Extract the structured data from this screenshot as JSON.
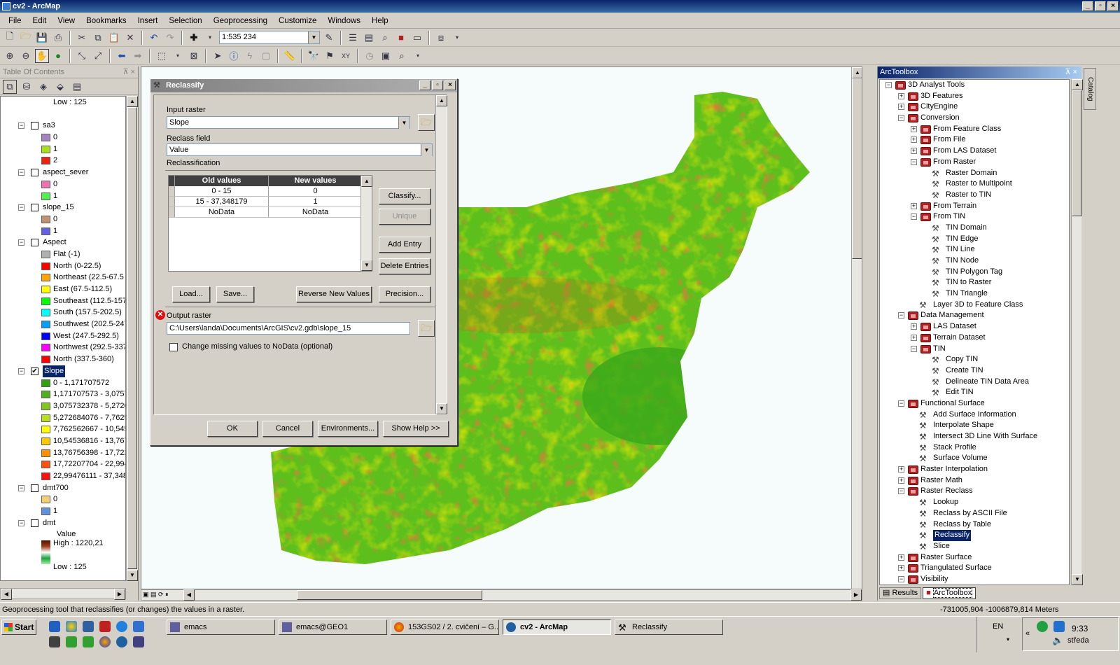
{
  "window": {
    "title": "cv2 - ArcMap"
  },
  "menu": [
    "File",
    "Edit",
    "View",
    "Bookmarks",
    "Insert",
    "Selection",
    "Geoprocessing",
    "Customize",
    "Windows",
    "Help"
  ],
  "toolbar": {
    "scale": "1:535 234"
  },
  "toc": {
    "title": "Table Of Contents",
    "top_low": "Low : 125",
    "layers": [
      {
        "name": "sa3",
        "checked": false,
        "classes": [
          {
            "label": "0",
            "color": "#a680c0"
          },
          {
            "label": "1",
            "color": "#a8e020"
          },
          {
            "label": "2",
            "color": "#f02010"
          }
        ]
      },
      {
        "name": "aspect_sever",
        "checked": false,
        "classes": [
          {
            "label": "0",
            "color": "#f070b0"
          },
          {
            "label": "1",
            "color": "#50f050"
          }
        ]
      },
      {
        "name": "slope_15",
        "checked": false,
        "classes": [
          {
            "label": "0",
            "color": "#c09070"
          },
          {
            "label": "1",
            "color": "#6060e0"
          }
        ]
      },
      {
        "name": "Aspect",
        "checked": false,
        "classes": [
          {
            "label": "Flat (-1)",
            "color": "#b0b0b0"
          },
          {
            "label": "North (0-22.5)",
            "color": "#ff0000"
          },
          {
            "label": "Northeast (22.5-67.5",
            "color": "#ffa500"
          },
          {
            "label": "East (67.5-112.5)",
            "color": "#ffff00"
          },
          {
            "label": "Southeast (112.5-157",
            "color": "#00ff00"
          },
          {
            "label": "South (157.5-202.5)",
            "color": "#00ffff"
          },
          {
            "label": "Southwest (202.5-247",
            "color": "#00a0ff"
          },
          {
            "label": "West (247.5-292.5)",
            "color": "#0000ff"
          },
          {
            "label": "Northwest (292.5-337",
            "color": "#ff00ff"
          },
          {
            "label": "North (337.5-360)",
            "color": "#ff0000"
          }
        ]
      },
      {
        "name": "Slope",
        "checked": true,
        "selected": true,
        "classes": [
          {
            "label": "0 - 1,171707572",
            "color": "#30a010"
          },
          {
            "label": "1,171707573 - 3,0757",
            "color": "#50b020"
          },
          {
            "label": "3,075732378 - 5,2726",
            "color": "#80c820"
          },
          {
            "label": "5,272684076 - 7,7625",
            "color": "#b8e020"
          },
          {
            "label": "7,762562667 - 10,545",
            "color": "#ffff00"
          },
          {
            "label": "10,54536816 - 13,767",
            "color": "#ffc800"
          },
          {
            "label": "13,76756398 - 17,722",
            "color": "#ff9000"
          },
          {
            "label": "17,72207704 - 22,994",
            "color": "#ff5010"
          },
          {
            "label": "22,99476111 - 37,348",
            "color": "#ff1010"
          }
        ]
      },
      {
        "name": "dmt700",
        "checked": false,
        "classes": [
          {
            "label": "0",
            "color": "#f0d070"
          },
          {
            "label": "1",
            "color": "#6090e0"
          }
        ]
      },
      {
        "name": "dmt",
        "checked": false,
        "value_label": "Value",
        "high": "High : 1220,21",
        "low": "Low : 125"
      }
    ]
  },
  "dialog": {
    "title": "Reclassify",
    "input_raster_label": "Input raster",
    "input_raster": "Slope",
    "reclass_field_label": "Reclass field",
    "reclass_field": "Value",
    "reclassification_label": "Reclassification",
    "table_headers": [
      "Old values",
      "New values"
    ],
    "rows": [
      [
        "0 - 15",
        "0"
      ],
      [
        "15 - 37,348179",
        "1"
      ],
      [
        "NoData",
        "NoData"
      ]
    ],
    "side_buttons": [
      "Classify...",
      "Unique",
      "Add Entry",
      "Delete Entries"
    ],
    "bottom_buttons": [
      "Load...",
      "Save...",
      "Reverse New Values",
      "Precision..."
    ],
    "output_raster_label": "Output raster",
    "output_raster": "C:\\Users\\landa\\Documents\\ArcGIS\\cv2.gdb\\slope_15",
    "nodata_option": "Change missing values to NoData (optional)",
    "footer_buttons": [
      "OK",
      "Cancel",
      "Environments...",
      "Show Help >>"
    ]
  },
  "toolbox": {
    "title": "ArcToolbox",
    "items": [
      {
        "label": "3D Analyst Tools",
        "level": 0,
        "type": "box",
        "exp": "-"
      },
      {
        "label": "3D Features",
        "level": 1,
        "type": "box",
        "exp": "+"
      },
      {
        "label": "CityEngine",
        "level": 1,
        "type": "box",
        "exp": "+"
      },
      {
        "label": "Conversion",
        "level": 1,
        "type": "box",
        "exp": "-"
      },
      {
        "label": "From Feature Class",
        "level": 2,
        "type": "box",
        "exp": "+"
      },
      {
        "label": "From File",
        "level": 2,
        "type": "box",
        "exp": "+"
      },
      {
        "label": "From LAS Dataset",
        "level": 2,
        "type": "box",
        "exp": "+"
      },
      {
        "label": "From Raster",
        "level": 2,
        "type": "box",
        "exp": "-"
      },
      {
        "label": "Raster Domain",
        "level": 3,
        "type": "tool"
      },
      {
        "label": "Raster to Multipoint",
        "level": 3,
        "type": "tool"
      },
      {
        "label": "Raster to TIN",
        "level": 3,
        "type": "tool"
      },
      {
        "label": "From Terrain",
        "level": 2,
        "type": "box",
        "exp": "+"
      },
      {
        "label": "From TIN",
        "level": 2,
        "type": "box",
        "exp": "-"
      },
      {
        "label": "TIN Domain",
        "level": 3,
        "type": "tool"
      },
      {
        "label": "TIN Edge",
        "level": 3,
        "type": "tool"
      },
      {
        "label": "TIN Line",
        "level": 3,
        "type": "tool"
      },
      {
        "label": "TIN Node",
        "level": 3,
        "type": "tool"
      },
      {
        "label": "TIN Polygon Tag",
        "level": 3,
        "type": "tool"
      },
      {
        "label": "TIN to Raster",
        "level": 3,
        "type": "tool"
      },
      {
        "label": "TIN Triangle",
        "level": 3,
        "type": "tool"
      },
      {
        "label": "Layer 3D to Feature Class",
        "level": 2,
        "type": "tool"
      },
      {
        "label": "Data Management",
        "level": 1,
        "type": "box",
        "exp": "-"
      },
      {
        "label": "LAS Dataset",
        "level": 2,
        "type": "box",
        "exp": "+"
      },
      {
        "label": "Terrain Dataset",
        "level": 2,
        "type": "box",
        "exp": "+"
      },
      {
        "label": "TIN",
        "level": 2,
        "type": "box",
        "exp": "-"
      },
      {
        "label": "Copy TIN",
        "level": 3,
        "type": "tool"
      },
      {
        "label": "Create TIN",
        "level": 3,
        "type": "tool"
      },
      {
        "label": "Delineate TIN Data Area",
        "level": 3,
        "type": "tool"
      },
      {
        "label": "Edit TIN",
        "level": 3,
        "type": "tool"
      },
      {
        "label": "Functional Surface",
        "level": 1,
        "type": "box",
        "exp": "-"
      },
      {
        "label": "Add Surface Information",
        "level": 2,
        "type": "tool"
      },
      {
        "label": "Interpolate Shape",
        "level": 2,
        "type": "tool"
      },
      {
        "label": "Intersect 3D Line With Surface",
        "level": 2,
        "type": "tool"
      },
      {
        "label": "Stack Profile",
        "level": 2,
        "type": "tool"
      },
      {
        "label": "Surface Volume",
        "level": 2,
        "type": "tool"
      },
      {
        "label": "Raster Interpolation",
        "level": 1,
        "type": "box",
        "exp": "+"
      },
      {
        "label": "Raster Math",
        "level": 1,
        "type": "box",
        "exp": "+"
      },
      {
        "label": "Raster Reclass",
        "level": 1,
        "type": "box",
        "exp": "-"
      },
      {
        "label": "Lookup",
        "level": 2,
        "type": "tool"
      },
      {
        "label": "Reclass by ASCII File",
        "level": 2,
        "type": "tool"
      },
      {
        "label": "Reclass by Table",
        "level": 2,
        "type": "tool"
      },
      {
        "label": "Reclassify",
        "level": 2,
        "type": "tool",
        "selected": true
      },
      {
        "label": "Slice",
        "level": 2,
        "type": "tool"
      },
      {
        "label": "Raster Surface",
        "level": 1,
        "type": "box",
        "exp": "+"
      },
      {
        "label": "Triangulated Surface",
        "level": 1,
        "type": "box",
        "exp": "+"
      },
      {
        "label": "Visibility",
        "level": 1,
        "type": "box",
        "exp": "-"
      }
    ],
    "tabs": [
      "Results",
      "ArcToolbox"
    ],
    "catalog_tab": "Catalog"
  },
  "status": {
    "message": "Geoprocessing tool that reclassifies (or changes) the values in a raster.",
    "coords": "-731005,904  -1006879,814 Meters"
  },
  "taskbar": {
    "start": "Start",
    "tasks": [
      "emacs",
      "emacs@GEO1",
      "153GS02 / 2. cvičení – G...",
      "cv2 - ArcMap",
      "Reclassify"
    ],
    "lang": "EN",
    "time": "9:33",
    "day": "středa"
  }
}
